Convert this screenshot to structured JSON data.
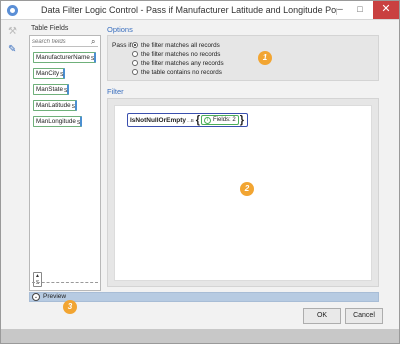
{
  "window": {
    "title": "Data Filter Logic Control - Pass if Manufacturer Latitude and Longitude Populated",
    "minimize": "–",
    "maximize": "□",
    "close": "✕"
  },
  "fields_panel": {
    "title": "Table Fields",
    "search_placeholder": "search fields",
    "fields": [
      {
        "name": "ManufacturerName",
        "type": "S"
      },
      {
        "name": "ManCity",
        "type": "S"
      },
      {
        "name": "ManState",
        "type": "S"
      },
      {
        "name": "ManLatitude",
        "type": "S"
      },
      {
        "name": "ManLongitude",
        "type": "S"
      }
    ],
    "sort_glyph": "▲\nS"
  },
  "options": {
    "title": "Options",
    "pass_if_label": "Pass if:",
    "choices": [
      {
        "label": "the filter matches all records",
        "selected": true
      },
      {
        "label": "the filter matches no records",
        "selected": false
      },
      {
        "label": "the filter matches any records",
        "selected": false
      },
      {
        "label": "the table contains no records",
        "selected": false
      }
    ]
  },
  "filter": {
    "title": "Filter",
    "function_name": "IsNotNullOrEmpty",
    "function_type": "...B",
    "open_brace": "{",
    "close_brace": "}",
    "info_glyph": "i",
    "fields_label": "Fields: 2"
  },
  "callouts": [
    "1",
    "2",
    "3"
  ],
  "preview": {
    "toggle_glyph": "⌄",
    "label": "Preview"
  },
  "buttons": {
    "ok": "OK",
    "cancel": "Cancel"
  },
  "colors": {
    "accent": "#3a6fbf",
    "callout": "#f2a532",
    "close": "#c94040",
    "field_green": "#6fb07a",
    "preview_bar": "#b7cbe2"
  }
}
